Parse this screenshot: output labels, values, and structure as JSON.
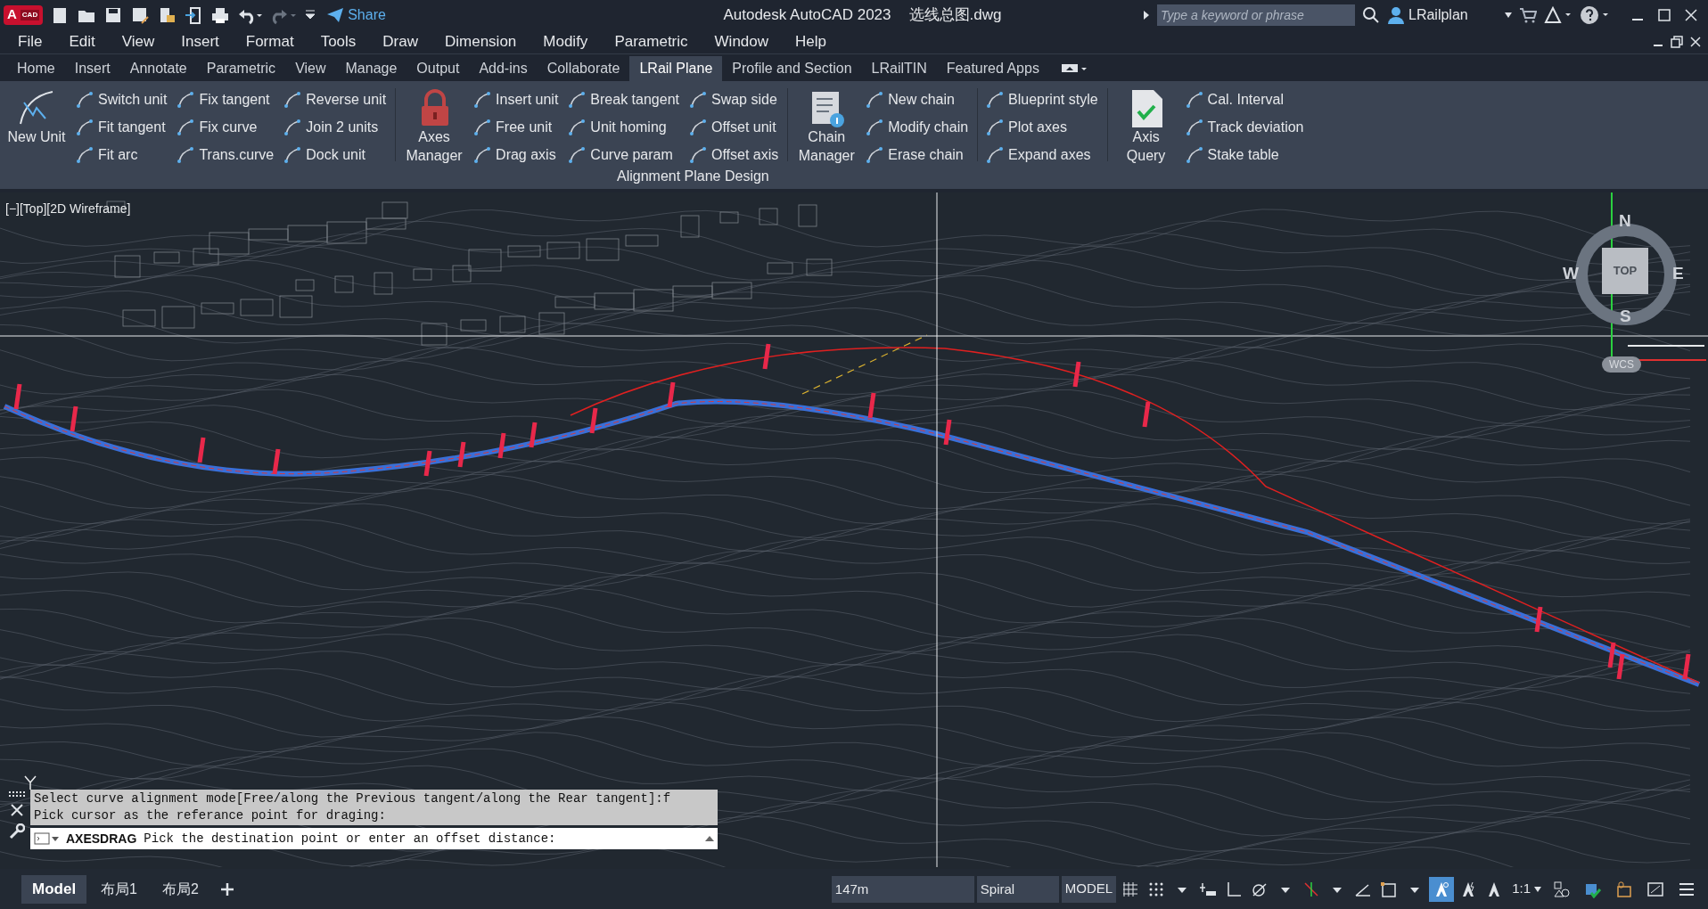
{
  "title_bar": {
    "badge_main": "A",
    "badge_sub": "CAD",
    "share": "Share",
    "app_title": "Autodesk AutoCAD 2023",
    "file_name": "选线总图.dwg",
    "search": {
      "placeholder": "Type a keyword or phrase"
    },
    "user": "LRailplan"
  },
  "menu": [
    "File",
    "Edit",
    "View",
    "Insert",
    "Format",
    "Tools",
    "Draw",
    "Dimension",
    "Modify",
    "Parametric",
    "Window",
    "Help"
  ],
  "ribbon_tabs": [
    {
      "label": "Home",
      "selected": false
    },
    {
      "label": "Insert",
      "selected": false
    },
    {
      "label": "Annotate",
      "selected": false
    },
    {
      "label": "Parametric",
      "selected": false
    },
    {
      "label": "View",
      "selected": false
    },
    {
      "label": "Manage",
      "selected": false
    },
    {
      "label": "Output",
      "selected": false
    },
    {
      "label": "Add-ins",
      "selected": false
    },
    {
      "label": "Collaborate",
      "selected": false
    },
    {
      "label": "LRail Plane",
      "selected": true
    },
    {
      "label": "Profile and Section",
      "selected": false
    },
    {
      "label": "LRailTIN",
      "selected": false
    },
    {
      "label": "Featured Apps",
      "selected": false
    }
  ],
  "ribbon_panel": {
    "title": "Alignment Plane Design",
    "groups": [
      [
        {
          "kind": "large",
          "label": "New Unit"
        },
        {
          "kind": "stack",
          "items": [
            "Switch unit",
            "Fit tangent",
            "Fit arc"
          ]
        },
        {
          "kind": "stack",
          "items": [
            "Fix tangent",
            "Fix curve",
            "Trans.curve"
          ]
        },
        {
          "kind": "stack",
          "items": [
            "Reverse unit",
            "Join 2 units",
            "Dock unit"
          ]
        }
      ],
      [
        {
          "kind": "large",
          "label": "Axes Manager"
        },
        {
          "kind": "stack",
          "items": [
            "Insert unit",
            "Free unit",
            "Drag axis"
          ]
        },
        {
          "kind": "stack",
          "items": [
            "Break tangent",
            "Unit homing",
            "Curve param"
          ]
        },
        {
          "kind": "stack",
          "items": [
            "Swap side",
            "Offset unit",
            "Offset axis"
          ]
        }
      ],
      [
        {
          "kind": "large",
          "label": "Chain Manager"
        },
        {
          "kind": "stack",
          "items": [
            "New chain",
            "Modify chain",
            "Erase chain"
          ]
        }
      ],
      [
        {
          "kind": "stack",
          "items": [
            "Blueprint style",
            "Plot axes",
            "Expand axes"
          ]
        }
      ],
      [
        {
          "kind": "large",
          "label": "Axis Query"
        },
        {
          "kind": "stack",
          "items": [
            "Cal. Interval",
            "Track deviation",
            "Stake table"
          ]
        }
      ]
    ]
  },
  "viewport": {
    "label": "[−][Top][2D Wireframe]",
    "compass": {
      "north": "N",
      "south": "S",
      "east": "E",
      "west": "W",
      "cube": "TOP",
      "ucs": "WCS"
    }
  },
  "command": {
    "history": [
      "Select curve alignment mode[Free/along the Previous tangent/along the Rear tangent]:f",
      "Pick cursor as the referance point for draging:"
    ],
    "command_name": "AXESDRAG",
    "prompt": "Pick the destination point or enter an offset distance:"
  },
  "layout_tabs": [
    {
      "label": "Model",
      "selected": true
    },
    {
      "label": "布局1",
      "selected": false
    },
    {
      "label": "布局2",
      "selected": false
    }
  ],
  "status_bar": {
    "coordinate": "147m",
    "mode": "Spiral",
    "space": "MODEL",
    "scale": "1:1",
    "annotation_visibility": {
      "on": true
    }
  }
}
